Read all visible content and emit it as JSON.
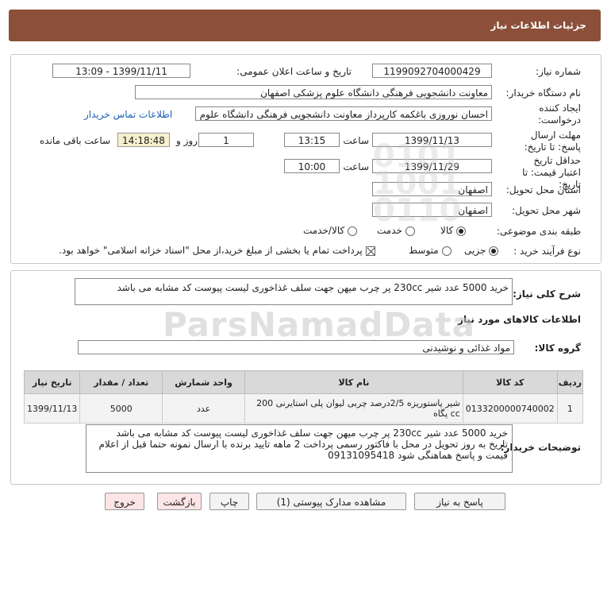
{
  "header": {
    "title": "جزئیات اطلاعات نیاز"
  },
  "info": {
    "need_number_label": "شماره نیاز:",
    "need_number": "1199092704000429",
    "announce_label": "تاریخ و ساعت اعلان عمومی:",
    "announce_value": "1399/11/11 - 13:09",
    "buyer_org_label": "نام دستگاه خریدار:",
    "buyer_org": "معاونت دانشجویی فرهنگی دانشگاه علوم پزشکی اصفهان",
    "creator_label": "ایجاد کننده درخواست:",
    "creator": "احسان نوروزی باغکمه کارپرداز معاونت دانشجویی فرهنگی دانشگاه علوم پزشکی",
    "contact_link": "اطلاعات تماس خریدار",
    "deadline_label": "مهلت ارسال پاسخ: تا تاریخ:",
    "deadline_date": "1399/11/13",
    "time_label": "ساعت",
    "deadline_time": "13:15",
    "days": "1",
    "days_label": "روز و",
    "remaining": "14:18:48",
    "remaining_label": "ساعت باقی مانده",
    "validity_label": "حداقل تاریخ اعتبار قیمت: تا تاریخ:",
    "validity_date": "1399/11/29",
    "validity_time": "10:00",
    "province_label": "استان محل تحویل:",
    "province": "اصفهان",
    "city_label": "شهر محل تحویل:",
    "city": "اصفهان",
    "category_label": "طبقه بندی موضوعی:",
    "category_options": [
      "کالا",
      "خدمت",
      "کالا/خدمت"
    ],
    "process_label": "نوع فرآیند خرید :",
    "process_options": [
      "جزیی",
      "متوسط"
    ],
    "payment_note": "پرداخت تمام یا بخشی از مبلغ خرید،از محل \"اسناد خزانه اسلامی\" خواهد بود."
  },
  "summary": {
    "label": "شرح کلی نیاز:",
    "text": "خرید 5000 عدد شیر 230cc پر چرب میهن جهت سلف غذاخوری لیست پیوست کد مشابه می باشد"
  },
  "goods": {
    "section_title": "اطلاعات کالاهای مورد نیاز",
    "group_label": "گروه کالا:",
    "group_value": "مواد غذائی و نوشیدنی",
    "columns": [
      "ردیف",
      "کد کالا",
      "نام کالا",
      "واحد شمارش",
      "تعداد / مقدار",
      "تاریخ نیاز"
    ],
    "rows": [
      [
        "1",
        "0133200000740002",
        "شیر پاستوریزه 2/5درصد چربی لیوان پلی استایرنی 200 cc پگاه",
        "عدد",
        "5000",
        "1399/11/13"
      ]
    ]
  },
  "buyer_notes": {
    "label": "توضیحات خریدار:",
    "lines": [
      "خرید 5000 عدد شیر 230cc پر چرب میهن جهت سلف غذاخوری لیست پیوست کد مشابه می باشد",
      "تاریخ به روز تحویل در محل با فاکتور رسمی پرداخت 2 ماهه تایید برنده با ارسال نمونه حتما قبل از اعلام",
      "قیمت و پاسخ هماهنگی شود 09131095418"
    ]
  },
  "buttons": {
    "reply": "پاسخ به نیاز",
    "attachments": "مشاهده مدارک پیوستی (1)",
    "print": "چاپ",
    "back": "بازگشت",
    "exit": "خروج"
  },
  "colors": {
    "header": "#8b4f3a",
    "link": "#1a5fb4",
    "remaining_bg": "#f6f0cc"
  }
}
